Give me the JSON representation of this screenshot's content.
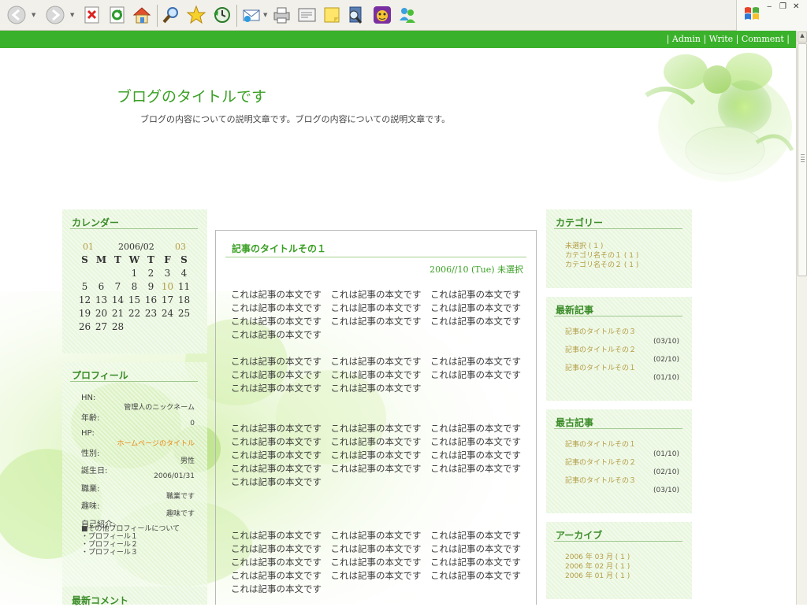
{
  "toolbar": {
    "icons": [
      "back-icon",
      "forward-icon",
      "stop-icon",
      "refresh-icon",
      "home-icon",
      "search-icon",
      "favorites-icon",
      "history-icon",
      "mail-icon",
      "print-icon",
      "edit-icon",
      "notes-icon",
      "research-icon",
      "messenger-icon",
      "messenger-people-icon"
    ]
  },
  "window": {
    "minimize": "‒",
    "restore": "❐",
    "close": "✕"
  },
  "header": {
    "admin_links": "| Admin | Write | Comment |",
    "title": "ブログのタイトルです",
    "description": "ブログの内容についての説明文章です。ブログの内容についての説明文章です。"
  },
  "calendar": {
    "title": "カレンダー",
    "prev": "01",
    "current": "2006/02",
    "next": "03",
    "weekdays": [
      "S",
      "M",
      "T",
      "W",
      "T",
      "F",
      "S"
    ],
    "weeks": [
      [
        "",
        "",
        "",
        "1",
        "2",
        "3",
        "4"
      ],
      [
        "5",
        "6",
        "7",
        "8",
        "9",
        "10",
        "11"
      ],
      [
        "12",
        "13",
        "14",
        "15",
        "16",
        "17",
        "18"
      ],
      [
        "19",
        "20",
        "21",
        "22",
        "23",
        "24",
        "25"
      ],
      [
        "26",
        "27",
        "28",
        "",
        "",
        "",
        ""
      ]
    ],
    "highlight_day": "10"
  },
  "profile": {
    "title": "プロフィール",
    "hn_label": "HN:",
    "hn_value": "管理人のニックネーム",
    "age_label": "年齢:",
    "age_value": "0",
    "hp_label": "HP:",
    "hp_value": "ホームページのタイトル",
    "gender_label": "性別:",
    "gender_value": "男性",
    "birthday_label": "誕生日:",
    "birthday_value": "2006/01/31",
    "job_label": "職業:",
    "job_value": "職業です",
    "hobby_label": "趣味:",
    "hobby_value": "趣味です",
    "intro_label": "自己紹介:",
    "intro_items": [
      "■その他プロフィールについて",
      "・プロフィール１",
      "・プロフィール２",
      "・プロフィール３"
    ]
  },
  "recent_comments": {
    "title": "最新コメント"
  },
  "post": {
    "title": "記事のタイトルその１",
    "meta": "2006/​/10 (Tue)  未選択",
    "paragraphs": [
      "これは記事の本文です　これは記事の本文です　これは記事の本文です　これは記事の本文です　これは記事の本文です　これは記事の本文です　これは記事の本文です　これは記事の本文です　これは記事の本文です　これは記事の本文です",
      "これは記事の本文です　これは記事の本文です　これは記事の本文です　これは記事の本文です　これは記事の本文です　これは記事の本文です　これは記事の本文です　これは記事の本文です",
      "これは記事の本文です　これは記事の本文です　これは記事の本文です　これは記事の本文です　これは記事の本文です　これは記事の本文です　これは記事の本文です　これは記事の本文です　これは記事の本文です　これは記事の本文です　これは記事の本文です　これは記事の本文です　これは記事の本文です",
      "これは記事の本文です　これは記事の本文です　これは記事の本文です　これは記事の本文です　これは記事の本文です　これは記事の本文です　これは記事の本文です　これは記事の本文です　これは記事の本文です　これは記事の本文です　これは記事の本文です　これは記事の本文です　これは記事の本文です"
    ]
  },
  "categories": {
    "title": "カテゴリー",
    "items": [
      "未選択 ( 1 )",
      "カテゴリ名その１ ( 1 )",
      "カテゴリ名その２ ( 1 )"
    ]
  },
  "latest_posts": {
    "title": "最新記事",
    "items": [
      {
        "title": "記事のタイトルその３",
        "date": "(03/10)"
      },
      {
        "title": "記事のタイトルその２",
        "date": "(02/10)"
      },
      {
        "title": "記事のタイトルその１",
        "date": "(01/10)"
      }
    ]
  },
  "oldest_posts": {
    "title": "最古記事",
    "items": [
      {
        "title": "記事のタイトルその１",
        "date": "(01/10)"
      },
      {
        "title": "記事のタイトルその２",
        "date": "(02/10)"
      },
      {
        "title": "記事のタイトルその３",
        "date": "(03/10)"
      }
    ]
  },
  "archive": {
    "title": "アーカイブ",
    "items": [
      "2006 年 03 月 ( 1 )",
      "2006 年 02 月 ( 1 )",
      "2006 年 01 月 ( 1 )"
    ]
  },
  "colors": {
    "accent": "#3ab12a",
    "title_green": "#3aa024",
    "link_gold": "#b39c44",
    "box_bg": "#e8f6dd"
  }
}
